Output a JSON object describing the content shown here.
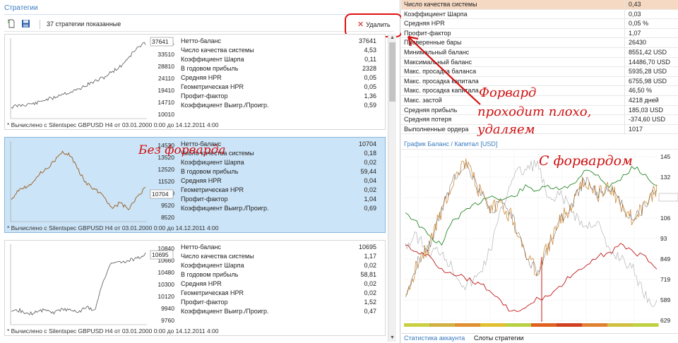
{
  "panel": {
    "title": "Стратегии",
    "count_label": "37 стратегии показанные",
    "delete_label": "Удалить"
  },
  "cards": [
    {
      "y_ticks": [
        "37641",
        "33510",
        "28810",
        "24110",
        "19410",
        "14710",
        "10010"
      ],
      "current_value": "37641",
      "labels": [
        "Нетто-баланс",
        "Число качества системы",
        "Коэффициент Шарпа",
        "В годовом прибыль",
        "Средняя HPR",
        "Геометрическая HPR",
        "Профит-фактор",
        "Коэффициент Выигр./Проигр."
      ],
      "values": [
        "37641",
        "4,53",
        "0,11",
        "2328",
        "0,05",
        "0,05",
        "1,36",
        "0,59"
      ],
      "footer": "* Вычислено с Silentspec GBPUSD H4 от 03.01.2000 0:00 до 14.12.2011 4:00"
    },
    {
      "y_ticks": [
        "14520",
        "13520",
        "12520",
        "11520",
        "10520",
        "9520",
        "8520"
      ],
      "current_value": "10704",
      "labels": [
        "Нетто-баланс",
        "Число качества системы",
        "Коэффициент Шарпа",
        "В годовом прибыль",
        "Средняя HPR",
        "Геометрическая HPR",
        "Профит-фактор",
        "Коэффициент Выигр./Проигр."
      ],
      "values": [
        "10704",
        "0,18",
        "0,02",
        "59,44",
        "0,04",
        "0,02",
        "1,04",
        "0,69"
      ],
      "footer": "* Вычислено с Silentspec GBPUSD H4 от 03.01.2000 0:00 до 14.12.2011 4:00"
    },
    {
      "y_ticks": [
        "10840",
        "10660",
        "10480",
        "10300",
        "10120",
        "9940",
        "9760"
      ],
      "current_value": "10695",
      "labels": [
        "Нетто-баланс",
        "Число качества системы",
        "Коэффициент Шарпа",
        "В годовом прибыль",
        "Средняя HPR",
        "Геометрическая HPR",
        "Профит-фактор",
        "Коэффициент Выигр./Проигр."
      ],
      "values": [
        "10695",
        "1,17",
        "0,02",
        "58,81",
        "0,02",
        "0,02",
        "1,52",
        "0,47"
      ],
      "footer": "* Вычислено с Silentspec GBPUSD H4 от 03.01.2000 0:00 до 14.12.2011 4:00"
    }
  ],
  "stats": [
    {
      "label": "Число качества системы",
      "value": "0,43"
    },
    {
      "label": "Коэффициент Шарпа",
      "value": "0,03"
    },
    {
      "label": "Средняя HPR",
      "value": "0,05 %"
    },
    {
      "label": "Профит-фактор",
      "value": "1,07"
    },
    {
      "label": "Проверенные бары",
      "value": "26430"
    },
    {
      "label": "Минимальный баланс",
      "value": "8551,42 USD"
    },
    {
      "label": "Максимальный баланс",
      "value": "14486,70 USD"
    },
    {
      "label": "Макс. просадка баланса",
      "value": "5935,28 USD"
    },
    {
      "label": "Макс. просадка капитала",
      "value": "6755,98 USD"
    },
    {
      "label": "Макс. просадка капитала",
      "value": "46,50 %"
    },
    {
      "label": "Макс. застой",
      "value": "4218 дней"
    },
    {
      "label": "Средняя прибыль",
      "value": "185,03 USD"
    },
    {
      "label": "Средняя потеря",
      "value": "-374,60 USD"
    },
    {
      "label": "Выполненные ордера",
      "value": "1017"
    }
  ],
  "graph": {
    "title": "График Баланс / Капитал [USD]",
    "y_ticks": [
      "145",
      "132",
      "1189",
      "106",
      "93",
      "849",
      "719",
      "589",
      "629"
    ],
    "current_label": "1189"
  },
  "tabs": [
    "Статистика аккаунта",
    "Слоты стратегии"
  ],
  "annotations": {
    "no_forward": "Без форварда",
    "forward_bad_1": "Форвард",
    "forward_bad_2": "проходит плохо,",
    "forward_bad_3": "удаляем",
    "with_forward": "С форвардом"
  },
  "colors": {
    "accent": "#3a7bbf",
    "annotation": "#d01010",
    "selection": "#cce4f7",
    "highlight_row": "#f5d9c3"
  }
}
